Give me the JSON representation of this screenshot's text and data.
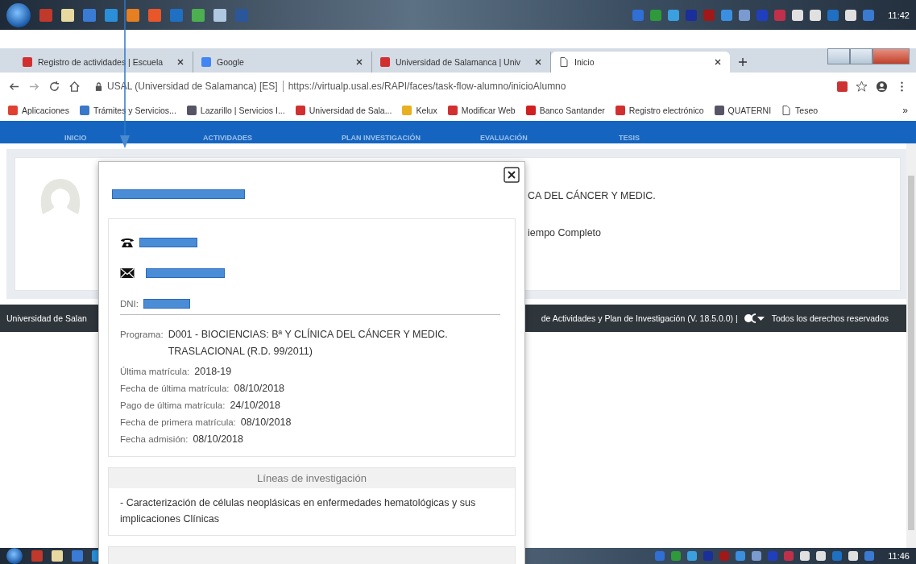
{
  "taskbar_top": {
    "time": "11:42"
  },
  "browser": {
    "tabs": [
      {
        "title": "Registro de actividades | Escuela",
        "kind": "usal",
        "selected": false
      },
      {
        "title": "Google",
        "kind": "google",
        "selected": false
      },
      {
        "title": "Universidad de Salamanca | Univ",
        "kind": "usal",
        "selected": false
      },
      {
        "title": "Inicio",
        "kind": "page",
        "selected": true
      }
    ],
    "site": "USAL (Universidad de Salamanca) [ES]",
    "url": "https://virtualp.usal.es/RAPI/faces/task-flow-alumno/inicioAlumno",
    "bookmarks": [
      {
        "title": "Aplicaciones",
        "kind": "apps"
      },
      {
        "title": "Trámites y Servicios...",
        "kind": "folder"
      },
      {
        "title": "Lazarillo | Servicios I...",
        "kind": "figure"
      },
      {
        "title": "Universidad de Sala...",
        "kind": "usal"
      },
      {
        "title": "Kelux",
        "kind": "star"
      },
      {
        "title": "Modificar Web",
        "kind": "usal"
      },
      {
        "title": "Banco Santander",
        "kind": "bank"
      },
      {
        "title": "Registro electrónico",
        "kind": "usal"
      },
      {
        "title": "QUATERNI",
        "kind": "figure"
      },
      {
        "title": "Teseo",
        "kind": "page"
      }
    ],
    "bookmarks_more": "»"
  },
  "nav": {
    "items": [
      "INICIO",
      "ACTIVIDADES",
      "PLAN INVESTIGACIÓN",
      "EVALUACIÓN",
      "TESIS"
    ]
  },
  "profile_card": {
    "lines": [
      "CA DEL CÁNCER Y MEDIC.",
      "iempo Completo"
    ]
  },
  "footer": {
    "left": "Universidad de Salan",
    "middle": "de Actividades y Plan de Investigación (V. 18.5.0.0) |",
    "right": "Todos los derechos reservados"
  },
  "modal": {
    "contacts": [
      {
        "kind": "phone"
      },
      {
        "kind": "email"
      }
    ],
    "dni_label": "DNI:",
    "fields": [
      {
        "label": "Programa:",
        "value": "D001 - BIOCIENCIAS: Bª Y CLÍNICA DEL CÁNCER Y MEDIC. TRASLACIONAL (R.D. 99/2011)"
      },
      {
        "label": "Última matrícula:",
        "value": "2018-19"
      },
      {
        "label": "Fecha de última matrícula:",
        "value": "08/10/2018"
      },
      {
        "label": "Pago de última matrícula:",
        "value": "24/10/2018"
      },
      {
        "label": "Fecha de primera matrícula:",
        "value": "08/10/2018"
      },
      {
        "label": "Fecha admisión:",
        "value": "08/10/2018"
      }
    ],
    "sections": [
      {
        "title": "Líneas de investigación",
        "body": "- Caracterización de células neoplásicas en enfermedades hematológicas y sus implicaciones Clínicas"
      }
    ]
  },
  "taskbar_bottom": {
    "time": "11:46"
  }
}
